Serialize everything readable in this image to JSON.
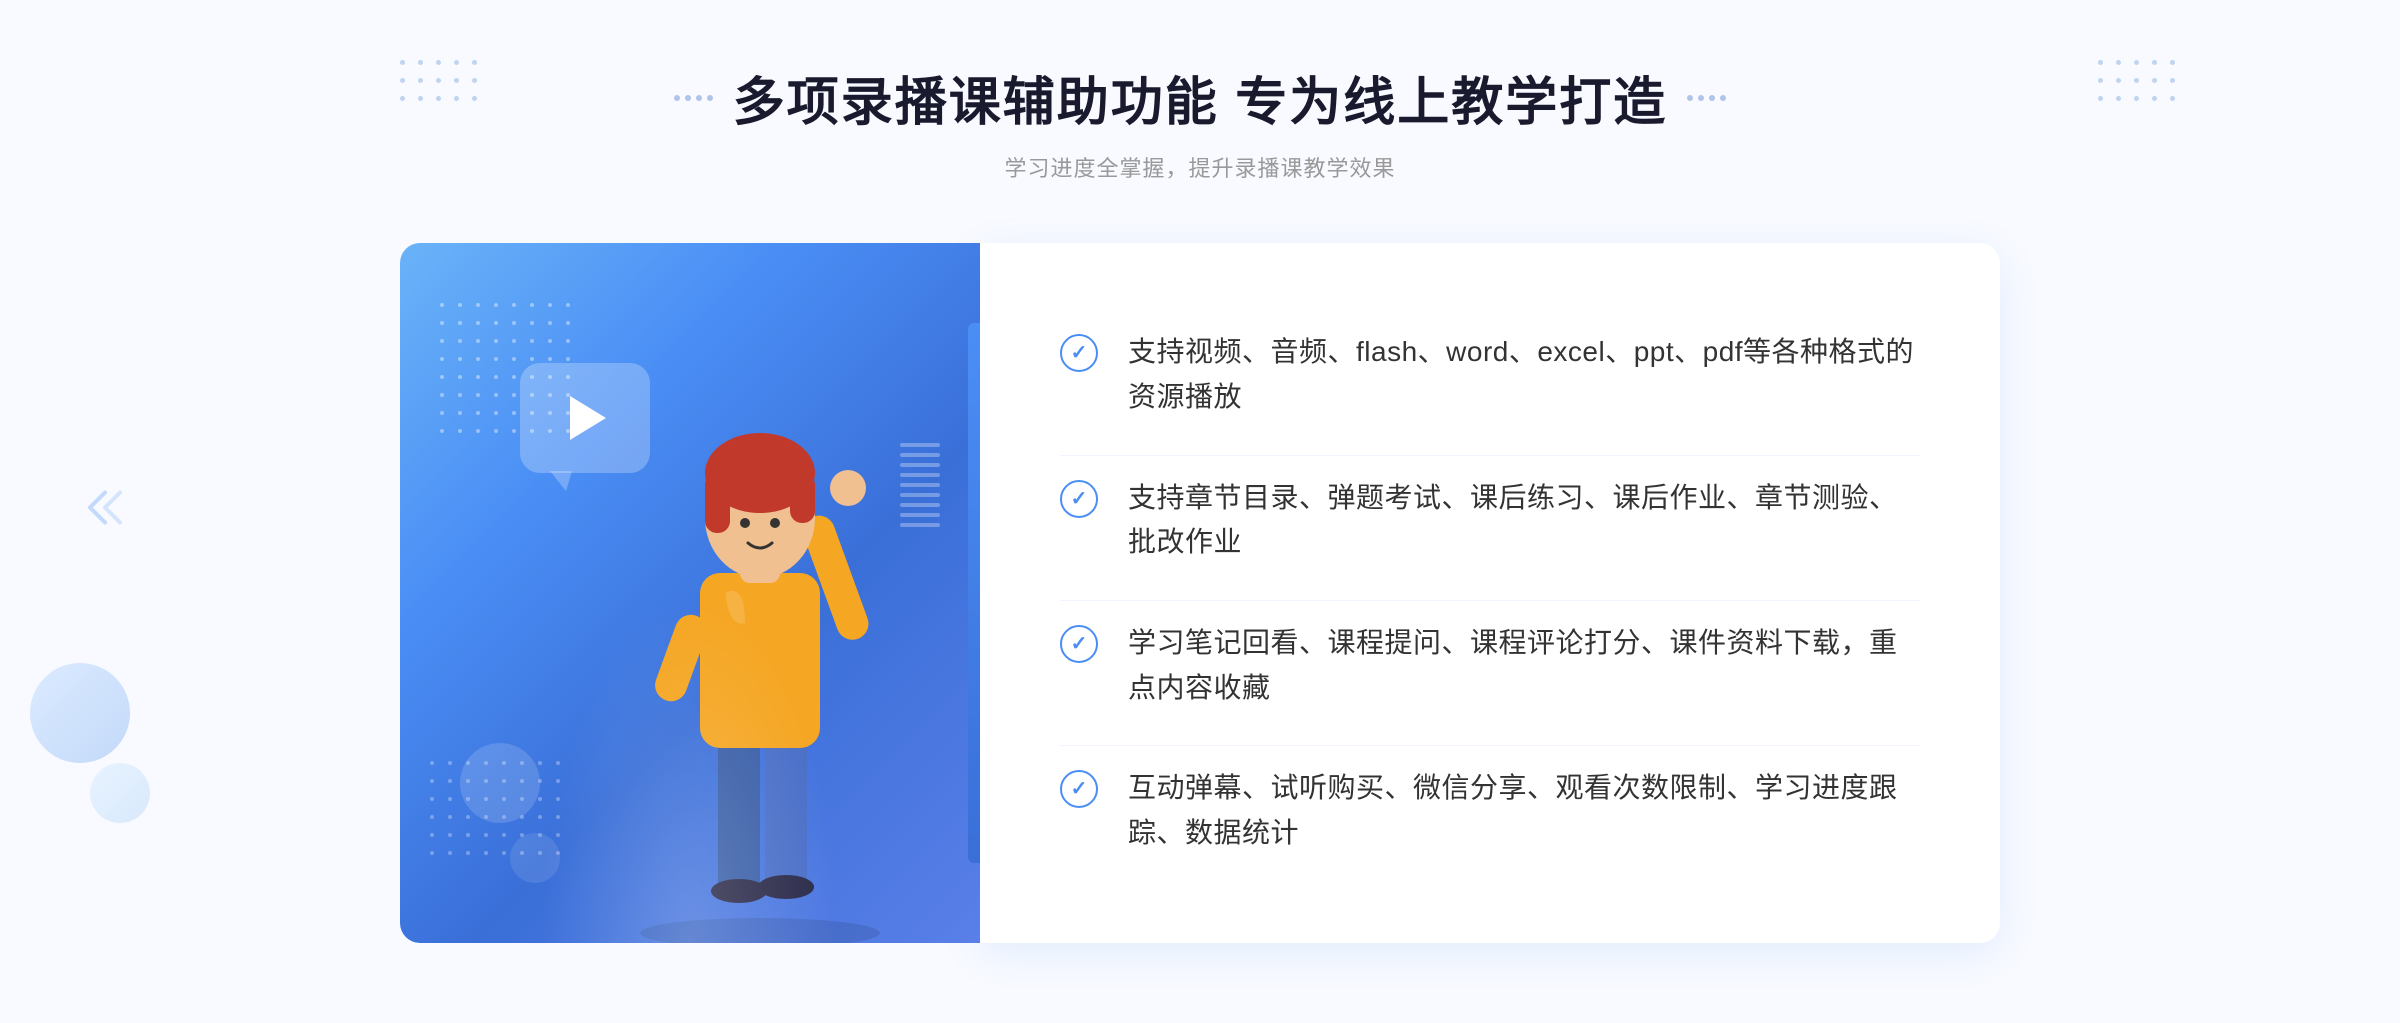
{
  "header": {
    "title": "多项录播课辅助功能 专为线上教学打造",
    "subtitle": "学习进度全掌握，提升录播课教学效果"
  },
  "features": [
    {
      "id": "feature-1",
      "text": "支持视频、音频、flash、word、excel、ppt、pdf等各种格式的资源播放"
    },
    {
      "id": "feature-2",
      "text": "支持章节目录、弹题考试、课后练习、课后作业、章节测验、批改作业"
    },
    {
      "id": "feature-3",
      "text": "学习笔记回看、课程提问、课程评论打分、课件资料下载，重点内容收藏"
    },
    {
      "id": "feature-4",
      "text": "互动弹幕、试听购买、微信分享、观看次数限制、学习进度跟踪、数据统计"
    }
  ],
  "colors": {
    "accent_blue": "#4a8ef5",
    "text_dark": "#1a1a2e",
    "text_gray": "#999999",
    "text_body": "#333333"
  }
}
